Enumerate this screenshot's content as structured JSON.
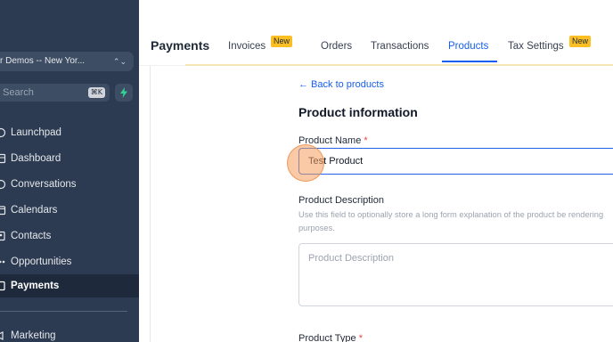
{
  "sidebar": {
    "account": "r Demos -- New Yor...",
    "search": {
      "label": "Search",
      "shortcut": "⌘K"
    },
    "items": [
      {
        "label": "Launchpad",
        "icon": "rocket-icon"
      },
      {
        "label": "Dashboard",
        "icon": "dashboard-icon"
      },
      {
        "label": "Conversations",
        "icon": "chat-icon"
      },
      {
        "label": "Calendars",
        "icon": "calendar-icon"
      },
      {
        "label": "Contacts",
        "icon": "contacts-icon"
      },
      {
        "label": "Opportunities",
        "icon": "filter-icon"
      },
      {
        "label": "Payments",
        "icon": "payments-icon",
        "active": true
      },
      {
        "label": "Marketing",
        "icon": "megaphone-icon"
      }
    ]
  },
  "header": {
    "title": "Payments",
    "tabs": [
      {
        "label": "Invoices",
        "badge": "New"
      },
      {
        "label": "Orders"
      },
      {
        "label": "Transactions"
      },
      {
        "label": "Products",
        "active": true
      },
      {
        "label": "Tax Settings",
        "badge": "New"
      }
    ]
  },
  "form": {
    "back_link": "← Back to products",
    "heading": "Product information",
    "name_label": "Product Name",
    "name_required": "*",
    "name_value": "Test Product",
    "desc_label": "Product Description",
    "desc_help": "Use this field to optionally store a long form explanation of the product be rendering purposes.",
    "desc_placeholder": "Product Description",
    "type_label": "Product Type",
    "type_required": "*"
  },
  "colors": {
    "accent": "#155eef",
    "sidebar": "#2c3b52",
    "badge": "#fbbf24"
  }
}
